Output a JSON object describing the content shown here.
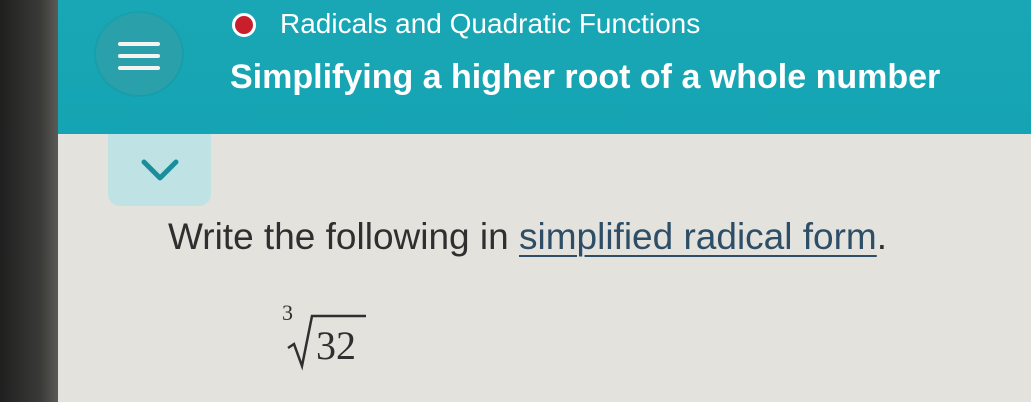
{
  "header": {
    "topic_title": "Radicals and Quadratic Functions",
    "lesson_title": "Simplifying a higher root of a whole number",
    "menu_icon": "hamburger-menu-icon",
    "status_dot_color": "#c81f2c",
    "background_color": "#15a4b3"
  },
  "panel": {
    "collapse_icon": "chevron-down-icon"
  },
  "question": {
    "instruction_prefix": "Write the following in ",
    "instruction_link": "simplified radical form",
    "instruction_suffix": ".",
    "radical_index": "3",
    "radicand": "32"
  }
}
